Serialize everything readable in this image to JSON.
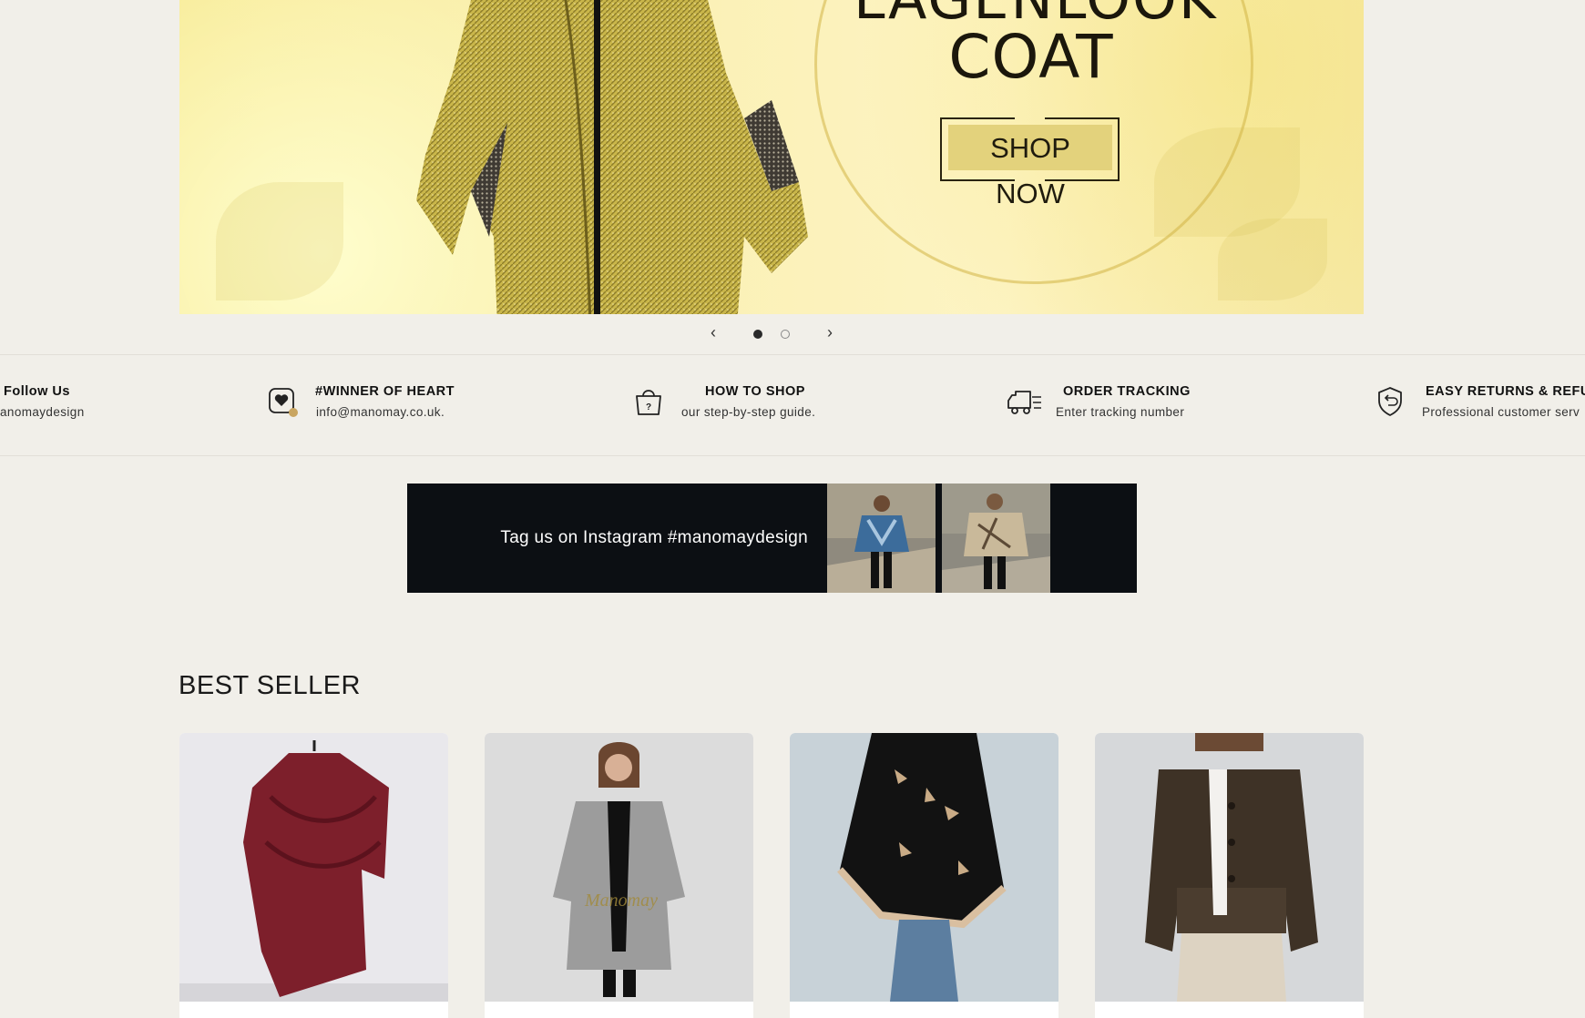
{
  "hero": {
    "title_top": "LAGENLOOK",
    "title": "COAT",
    "cta_label": "SHOP NOW",
    "slides_total": 2,
    "active_slide": 1
  },
  "carousel": {
    "prev_icon": "chevron-left-icon",
    "next_icon": "chevron-right-icon"
  },
  "features": [
    {
      "title": "Follow Us",
      "subtitle": "anomaydesign",
      "icon": "instagram-icon"
    },
    {
      "title": "#WINNER OF HEART",
      "subtitle": "info@manomay.co.uk.",
      "icon": "heart-badge-icon"
    },
    {
      "title": "HOW TO SHOP",
      "subtitle": "our step-by-step guide.",
      "icon": "shopping-bag-question-icon"
    },
    {
      "title": "ORDER TRACKING",
      "subtitle": "Enter tracking number",
      "icon": "delivery-truck-icon"
    },
    {
      "title": "EASY RETURNS & REFUI",
      "subtitle": "Professional customer serv",
      "icon": "shield-return-icon"
    }
  ],
  "instagram": {
    "text": "Tag us on Instagram #manomaydesign"
  },
  "best_seller": {
    "title": "BEST SELLER",
    "products": [
      {
        "name": "burgundy-wrap-shawl"
      },
      {
        "name": "grey-wool-coat"
      },
      {
        "name": "black-floral-poncho"
      },
      {
        "name": "brown-cropped-jacket"
      }
    ]
  },
  "colors": {
    "background": "#f1efe9",
    "hero_yellow": "#fbf1b7",
    "cta_gold": "#e3d27c",
    "insta_bg": "#0c0f13"
  }
}
